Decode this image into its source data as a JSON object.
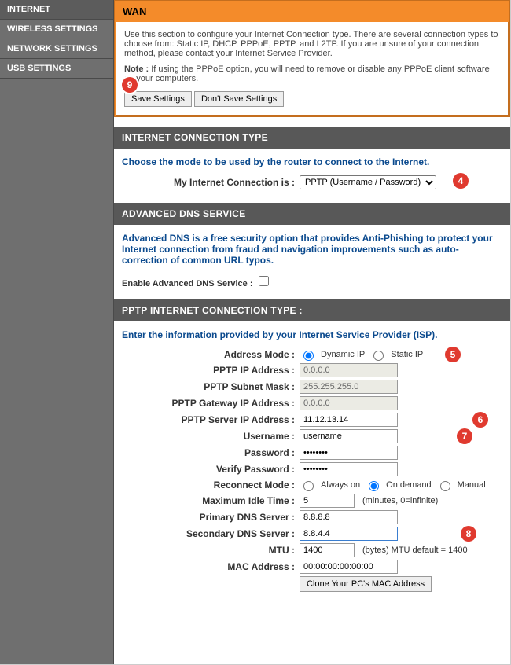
{
  "sidebar": {
    "items": [
      {
        "label": "INTERNET"
      },
      {
        "label": "WIRELESS SETTINGS"
      },
      {
        "label": "NETWORK SETTINGS"
      },
      {
        "label": "USB SETTINGS"
      }
    ]
  },
  "wan": {
    "title": "WAN",
    "desc": "Use this section to configure your Internet Connection type. There are several connection types to choose from: Static IP, DHCP, PPPoE, PPTP, and L2TP. If you are unsure of your connection method, please contact your Internet Service Provider.",
    "note_label": "Note : ",
    "note": "If using the PPPoE option, you will need to remove or disable any PPPoE client software on your computers.",
    "save": "Save Settings",
    "dont": "Don't Save Settings"
  },
  "ict": {
    "bar": "INTERNET CONNECTION TYPE",
    "intro": "Choose the mode to be used by the router to connect to the Internet.",
    "label": "My Internet Connection is :",
    "selected": "PPTP (Username / Password)"
  },
  "adv": {
    "bar": "ADVANCED DNS SERVICE",
    "intro": "Advanced DNS is a free security option that provides Anti-Phishing to protect your Internet connection from fraud and navigation improvements such as auto-correction of common URL typos.",
    "label": "Enable Advanced DNS Service :"
  },
  "pptp": {
    "bar": "PPTP INTERNET CONNECTION TYPE :",
    "intro": "Enter the information provided by your Internet Service Provider (ISP).",
    "fields": {
      "addr_mode": "Address Mode :",
      "dyn": "Dynamic IP",
      "stat": "Static IP",
      "ip": "PPTP IP Address :",
      "ip_v": "0.0.0.0",
      "mask": "PPTP Subnet Mask :",
      "mask_v": "255.255.255.0",
      "gw": "PPTP Gateway IP Address :",
      "gw_v": "0.0.0.0",
      "srv": "PPTP Server IP Address :",
      "srv_v": "11.12.13.14",
      "user": "Username :",
      "user_v": "username",
      "pass": "Password :",
      "pass_v": "password",
      "vpass": "Verify Password :",
      "vpass_v": "password",
      "recon": "Reconnect Mode :",
      "always": "Always on",
      "ondemand": "On demand",
      "manual": "Manual",
      "idle": "Maximum Idle Time :",
      "idle_v": "5",
      "idle_after": "(minutes, 0=infinite)",
      "dns1": "Primary DNS Server :",
      "dns1_v": "8.8.8.8",
      "dns2": "Secondary DNS Server :",
      "dns2_v": "8.8.4.4",
      "mtu": "MTU :",
      "mtu_v": "1400",
      "mtu_after": "(bytes) MTU default = 1400",
      "mac": "MAC Address :",
      "mac_v": "00:00:00:00:00:00",
      "clone": "Clone Your PC's MAC Address"
    }
  },
  "badges": {
    "b4": "4",
    "b5": "5",
    "b6": "6",
    "b7": "7",
    "b8": "8",
    "b9": "9"
  }
}
